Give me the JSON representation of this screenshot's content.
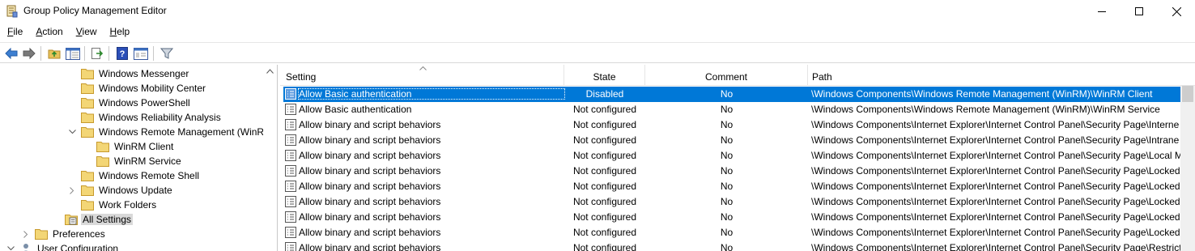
{
  "window": {
    "title": "Group Policy Management Editor"
  },
  "menu": [
    {
      "label_u": "F",
      "label_rest": "ile"
    },
    {
      "label_u": "A",
      "label_rest": "ction"
    },
    {
      "label_u": "V",
      "label_rest": "iew"
    },
    {
      "label_u": "H",
      "label_rest": "elp"
    }
  ],
  "toolbar": {
    "icons": [
      "back-icon",
      "forward-icon",
      "up-folder-icon",
      "show-hide-tree-icon",
      "export-list-icon",
      "help-icon",
      "properties-icon",
      "filter-icon"
    ]
  },
  "tree": {
    "items": [
      {
        "label": "Windows Messenger"
      },
      {
        "label": "Windows Mobility Center"
      },
      {
        "label": "Windows PowerShell"
      },
      {
        "label": "Windows Reliability Analysis"
      },
      {
        "label": "Windows Remote Management (WinR"
      },
      {
        "label": "WinRM Client"
      },
      {
        "label": "WinRM Service"
      },
      {
        "label": "Windows Remote Shell"
      },
      {
        "label": "Windows Update"
      },
      {
        "label": "Work Folders"
      },
      {
        "label": "All Settings"
      },
      {
        "label": "Preferences"
      },
      {
        "label": "User Configuration"
      }
    ]
  },
  "list": {
    "columns": {
      "setting": "Setting",
      "state": "State",
      "comment": "Comment",
      "path": "Path"
    },
    "rows": [
      {
        "setting": "Allow Basic authentication",
        "state": "Disabled",
        "comment": "No",
        "path": "\\Windows Components\\Windows Remote Management (WinRM)\\WinRM Client"
      },
      {
        "setting": "Allow Basic authentication",
        "state": "Not configured",
        "comment": "No",
        "path": "\\Windows Components\\Windows Remote Management (WinRM)\\WinRM Service"
      },
      {
        "setting": "Allow binary and script behaviors",
        "state": "Not configured",
        "comment": "No",
        "path": "\\Windows Components\\Internet Explorer\\Internet Control Panel\\Security Page\\Interne"
      },
      {
        "setting": "Allow binary and script behaviors",
        "state": "Not configured",
        "comment": "No",
        "path": "\\Windows Components\\Internet Explorer\\Internet Control Panel\\Security Page\\Intrane"
      },
      {
        "setting": "Allow binary and script behaviors",
        "state": "Not configured",
        "comment": "No",
        "path": "\\Windows Components\\Internet Explorer\\Internet Control Panel\\Security Page\\Local M"
      },
      {
        "setting": "Allow binary and script behaviors",
        "state": "Not configured",
        "comment": "No",
        "path": "\\Windows Components\\Internet Explorer\\Internet Control Panel\\Security Page\\Locked"
      },
      {
        "setting": "Allow binary and script behaviors",
        "state": "Not configured",
        "comment": "No",
        "path": "\\Windows Components\\Internet Explorer\\Internet Control Panel\\Security Page\\Locked"
      },
      {
        "setting": "Allow binary and script behaviors",
        "state": "Not configured",
        "comment": "No",
        "path": "\\Windows Components\\Internet Explorer\\Internet Control Panel\\Security Page\\Locked"
      },
      {
        "setting": "Allow binary and script behaviors",
        "state": "Not configured",
        "comment": "No",
        "path": "\\Windows Components\\Internet Explorer\\Internet Control Panel\\Security Page\\Locked"
      },
      {
        "setting": "Allow binary and script behaviors",
        "state": "Not configured",
        "comment": "No",
        "path": "\\Windows Components\\Internet Explorer\\Internet Control Panel\\Security Page\\Locked"
      },
      {
        "setting": "Allow binary and script behaviors",
        "state": "Not configured",
        "comment": "No",
        "path": "\\Windows Components\\Internet Explorer\\Internet Control Panel\\Security Page\\Restrict"
      }
    ]
  },
  "colors": {
    "selection": "#0078d7",
    "folder": "#e8c25a",
    "folder_edge": "#c79a2c"
  }
}
